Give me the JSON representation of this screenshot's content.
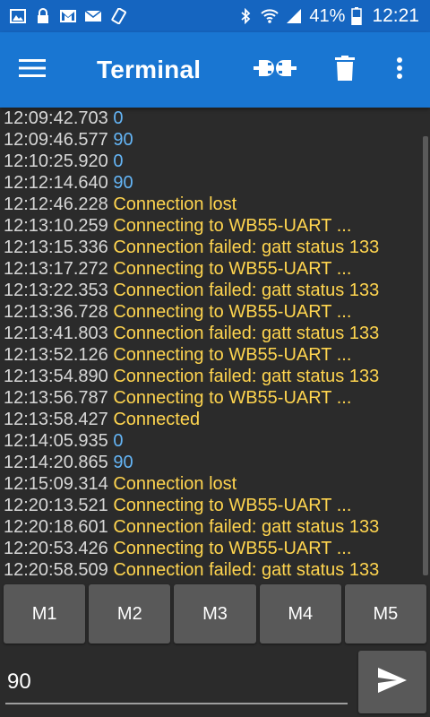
{
  "status_bar": {
    "icons": [
      "image-icon",
      "lock-icon",
      "gmail-icon",
      "mail-icon",
      "screen-rotate-icon",
      "bluetooth-icon",
      "wifi-icon",
      "signal-icon",
      "battery-icon"
    ],
    "battery_percent": "41%",
    "clock": "12:21",
    "background": "#1565c0"
  },
  "app_bar": {
    "title": "Terminal",
    "menu_icon": "hamburger-menu-icon",
    "actions": [
      "connect-icon",
      "delete-icon",
      "more-vert-icon"
    ],
    "background": "#1976d2"
  },
  "terminal": {
    "colors": {
      "timestamp": "#d7d7d7",
      "status": "#ffd54f",
      "data": "#64b5f6"
    },
    "lines": [
      {
        "time": "12:09:42.703",
        "text": "0",
        "kind": "data"
      },
      {
        "time": "12:09:46.577",
        "text": "90",
        "kind": "data"
      },
      {
        "time": "12:10:25.920",
        "text": "0",
        "kind": "data"
      },
      {
        "time": "12:12:14.640",
        "text": "90",
        "kind": "data"
      },
      {
        "time": "12:12:46.228",
        "text": "Connection lost",
        "kind": "status"
      },
      {
        "time": "12:13:10.259",
        "text": "Connecting to WB55-UART ...",
        "kind": "status"
      },
      {
        "time": "12:13:15.336",
        "text": "Connection failed: gatt status 133",
        "kind": "status"
      },
      {
        "time": "12:13:17.272",
        "text": "Connecting to WB55-UART ...",
        "kind": "status"
      },
      {
        "time": "12:13:22.353",
        "text": "Connection failed: gatt status 133",
        "kind": "status"
      },
      {
        "time": "12:13:36.728",
        "text": "Connecting to WB55-UART ...",
        "kind": "status"
      },
      {
        "time": "12:13:41.803",
        "text": "Connection failed: gatt status 133",
        "kind": "status"
      },
      {
        "time": "12:13:52.126",
        "text": "Connecting to WB55-UART ...",
        "kind": "status"
      },
      {
        "time": "12:13:54.890",
        "text": "Connection failed: gatt status 133",
        "kind": "status"
      },
      {
        "time": "12:13:56.787",
        "text": "Connecting to WB55-UART ...",
        "kind": "status"
      },
      {
        "time": "12:13:58.427",
        "text": "Connected",
        "kind": "status"
      },
      {
        "time": "12:14:05.935",
        "text": "0",
        "kind": "data"
      },
      {
        "time": "12:14:20.865",
        "text": "90",
        "kind": "data"
      },
      {
        "time": "12:15:09.314",
        "text": "Connection lost",
        "kind": "status"
      },
      {
        "time": "12:20:13.521",
        "text": "Connecting to WB55-UART ...",
        "kind": "status"
      },
      {
        "time": "12:20:18.601",
        "text": "Connection failed: gatt status 133",
        "kind": "status"
      },
      {
        "time": "12:20:53.426",
        "text": "Connecting to WB55-UART ...",
        "kind": "status"
      },
      {
        "time": "12:20:58.509",
        "text": "Connection failed: gatt status 133",
        "kind": "status"
      }
    ]
  },
  "macros": {
    "buttons": [
      "M1",
      "M2",
      "M3",
      "M4",
      "M5"
    ]
  },
  "input": {
    "value": "90",
    "send_icon": "send-icon"
  }
}
